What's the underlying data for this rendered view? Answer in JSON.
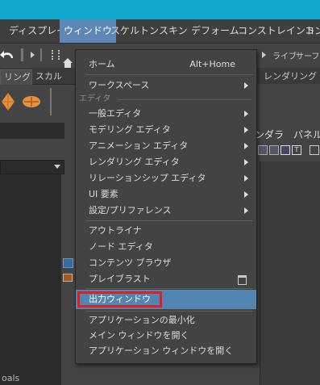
{
  "menubar": {
    "items": [
      "ディスプレイ",
      "ウィンドウ",
      "スケルトン",
      "スキン",
      "デフォーム",
      "コンストレイント",
      "コン"
    ]
  },
  "toolbar": {
    "live_label": "ライブ",
    "surface_label": "サーフェス"
  },
  "tabs": [
    "リング",
    "スカル",
    "レンダリング"
  ],
  "right": {
    "panel_label_1": "ンダラ",
    "panel_label_2": "パネル",
    "value": "0."
  },
  "left": {
    "partial_text": "oals"
  },
  "menu": {
    "home": {
      "label": "ホーム",
      "shortcut": "Alt+Home"
    },
    "workspace": "ワークスペース",
    "editor_header": "エディタ",
    "editors": [
      "一般エディタ",
      "モデリング エディタ",
      "アニメーション エディタ",
      "レンダリング エディタ",
      "リレーションシップ エディタ",
      "UI 要素",
      "設定/プリファレンス"
    ],
    "tools": [
      "アウトライナ",
      "ノード エディタ",
      "コンテンツ ブラウザ",
      "プレイブラスト"
    ],
    "output_window": "出力ウィンドウ",
    "app": [
      "アプリケーションの最小化",
      "メイン ウィンドウを開く",
      "アプリケーション ウィンドウを開く"
    ]
  },
  "colors": {
    "highlight": "#5285b1",
    "annotation_box": "#e02020",
    "title_strip": "#12a8cc"
  }
}
